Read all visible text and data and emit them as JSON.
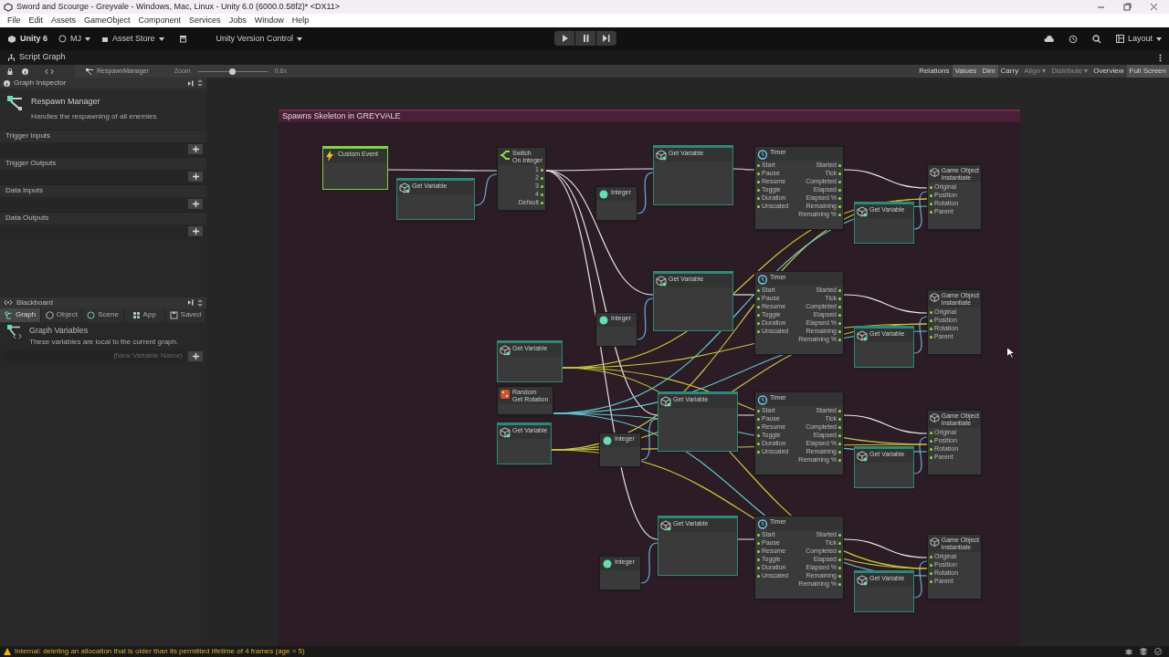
{
  "window": {
    "title": "Sword and Scourge - Greyvale - Windows, Mac, Linux - Unity 6.0 (6000.0.58f2)* <DX11>"
  },
  "menu": [
    "File",
    "Edit",
    "Assets",
    "GameObject",
    "Component",
    "Services",
    "Jobs",
    "Window",
    "Help"
  ],
  "toolbar": {
    "product": "Unity 6",
    "account": "MJ",
    "store": "Asset Store",
    "version_control": "Unity Version Control",
    "layout": "Layout"
  },
  "editor_tab": "Script Graph",
  "graph_toolbar": {
    "graph_name": "RespawnManager",
    "zoom_label": "Zoom",
    "zoom": {
      "level": 0.5
    },
    "zoom_reading": "0.6x",
    "toggles": [
      {
        "label": "Relations",
        "on": false,
        "disabled": false
      },
      {
        "label": "Values",
        "on": true,
        "disabled": false
      },
      {
        "label": "Dim",
        "on": true,
        "disabled": false
      },
      {
        "label": "Carry",
        "on": false,
        "disabled": false
      },
      {
        "label": "Align ▾",
        "on": false,
        "disabled": true
      },
      {
        "label": "Distribute ▾",
        "on": false,
        "disabled": true
      },
      {
        "label": "Overview",
        "on": false,
        "disabled": false
      },
      {
        "label": "Full Screen",
        "on": true,
        "disabled": false
      }
    ]
  },
  "inspector": {
    "title": "Graph Inspector",
    "graph_title": "Respawn Manager",
    "graph_summary": "Handles the respawning of all enemies",
    "sections": [
      "Trigger Inputs",
      "Trigger Outputs",
      "Data Inputs",
      "Data Outputs"
    ]
  },
  "blackboard": {
    "title": "Blackboard",
    "tabs": [
      {
        "label": "Graph",
        "selected": true
      },
      {
        "label": "Object",
        "selected": false
      },
      {
        "label": "Scene",
        "selected": false
      },
      {
        "label": "App",
        "selected": false
      },
      {
        "label": "Saved",
        "selected": false
      }
    ],
    "heading": "Graph Variables",
    "description": "These variables are local to the current graph.",
    "new_variable": {
      "placeholder": "(New Variable Name)"
    }
  },
  "group": {
    "title": "Spawns Skeleton in GREYVALE"
  },
  "nodes": [
    {
      "kind": "event",
      "title": "Custom Event"
    },
    {
      "kind": "variable",
      "title": "Get Variable"
    },
    {
      "kind": "switch",
      "title": "Switch",
      "subtitle": "On Integer",
      "outputs": [
        "1",
        "2",
        "3",
        "4",
        "Default"
      ]
    },
    {
      "kind": "integer",
      "title": "Integer"
    },
    {
      "kind": "variable",
      "title": "Get Variable"
    },
    {
      "kind": "timer",
      "title": "Timer",
      "inputs": [
        "Start",
        "Pause",
        "Resume",
        "Toggle",
        "Duration",
        "Unscaled"
      ],
      "outputs": [
        "Started",
        "Tick",
        "Completed",
        "Elapsed",
        "Elapsed %",
        "Remaining",
        "Remaining %"
      ]
    },
    {
      "kind": "variable",
      "title": "Get Variable"
    },
    {
      "kind": "instantiate",
      "title": "Game Object",
      "subtitle": "Instantiate",
      "inputs": [
        "Original",
        "Position",
        "Rotation",
        "Parent"
      ]
    },
    {
      "kind": "integer",
      "title": "Integer"
    },
    {
      "kind": "variable",
      "title": "Get Variable"
    },
    {
      "kind": "timer",
      "title": "Timer",
      "inputs": [
        "Start",
        "Pause",
        "Resume",
        "Toggle",
        "Duration",
        "Unscaled"
      ],
      "outputs": [
        "Started",
        "Tick",
        "Completed",
        "Elapsed",
        "Elapsed %",
        "Remaining",
        "Remaining %"
      ]
    },
    {
      "kind": "variable",
      "title": "Get Variable"
    },
    {
      "kind": "instantiate",
      "title": "Game Object",
      "subtitle": "Instantiate",
      "inputs": [
        "Original",
        "Position",
        "Rotation",
        "Parent"
      ]
    },
    {
      "kind": "variable",
      "title": "Get Variable"
    },
    {
      "kind": "random",
      "title": "Random",
      "subtitle": "Get Rotation"
    },
    {
      "kind": "variable",
      "title": "Get Variable"
    },
    {
      "kind": "integer",
      "title": "Integer"
    },
    {
      "kind": "variable",
      "title": "Get Variable"
    },
    {
      "kind": "timer",
      "title": "Timer",
      "inputs": [
        "Start",
        "Pause",
        "Resume",
        "Toggle",
        "Duration",
        "Unscaled"
      ],
      "outputs": [
        "Started",
        "Tick",
        "Completed",
        "Elapsed",
        "Elapsed %",
        "Remaining",
        "Remaining %"
      ]
    },
    {
      "kind": "variable",
      "title": "Get Variable"
    },
    {
      "kind": "instantiate",
      "title": "Game Object",
      "subtitle": "Instantiate",
      "inputs": [
        "Original",
        "Position",
        "Rotation",
        "Parent"
      ]
    },
    {
      "kind": "integer",
      "title": "Integer"
    },
    {
      "kind": "variable",
      "title": "Get Variable"
    },
    {
      "kind": "timer",
      "title": "Timer",
      "inputs": [
        "Start",
        "Pause",
        "Resume",
        "Toggle",
        "Duration",
        "Unscaled"
      ],
      "outputs": [
        "Started",
        "Tick",
        "Completed",
        "Elapsed",
        "Elapsed %",
        "Remaining",
        "Remaining %"
      ]
    },
    {
      "kind": "variable",
      "title": "Get Variable"
    },
    {
      "kind": "instantiate",
      "title": "Game Object",
      "subtitle": "Instantiate",
      "inputs": [
        "Original",
        "Position",
        "Rotation",
        "Parent"
      ]
    }
  ],
  "status_bar": {
    "message": "Internal: deleting an allocation that is older than its permitted lifetime of 4 frames (age = 5)"
  }
}
